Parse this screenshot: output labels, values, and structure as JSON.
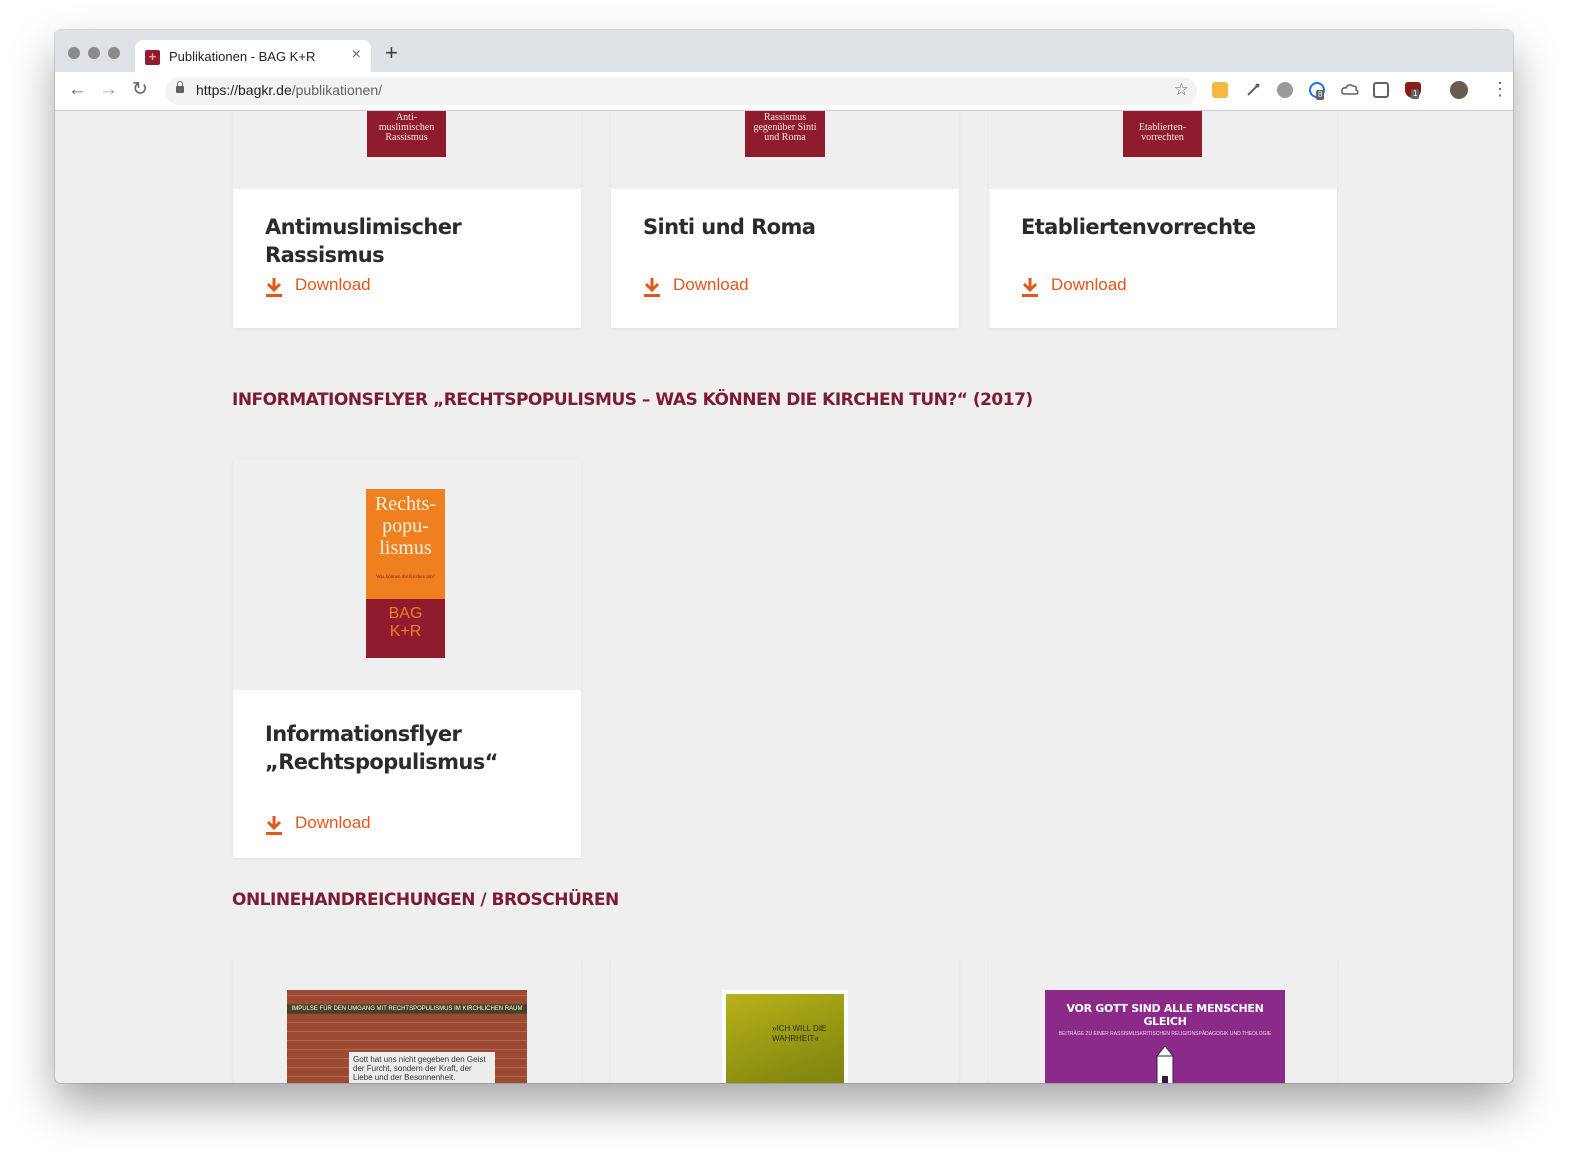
{
  "browser": {
    "tab_title": "Publikationen - BAG K+R",
    "tab_close": "×",
    "new_tab": "+",
    "url_host": "https://bagkr.de",
    "url_path": "/publikationen/",
    "back": "←",
    "forward": "→",
    "reload": "↻",
    "bookmark_star": "☆",
    "menu": "⋮",
    "extension_badges": {
      "ext4": "8",
      "ext8": "1"
    },
    "extensions": [
      "amazon-assistant-icon",
      "eyedropper-icon",
      "gear-extension-icon",
      "colorful-gear-extension-icon",
      "cloud-icon",
      "lightbulb-extension-icon",
      "ublock-extension-icon",
      "profile-avatar"
    ]
  },
  "colors": {
    "accent": "#e2571b",
    "heading": "#7d1b34",
    "cover_maroon": "#8e1c2e",
    "cover_orange": "#f07f20"
  },
  "covers": {
    "antimuslim": "Anti-\nmuslimischen\nRassismus",
    "sinti": "Rassismus\ngegenüber Sinti\nund Roma",
    "etabliert": "Etablierten-\nvorrechten",
    "flyer_title": "Rechts-\npopu-\nlismus",
    "flyer_sub": "Was können die Kirchen tun?",
    "flyer_logo_bag": "BAG",
    "flyer_logo_kr": "K+R",
    "brosch1_banner": "IMPULSE FÜR DEN UMGANG MIT RECHTSPOPULISMUS IM KIRCHLICHEN RAUM",
    "brosch1_quote": "Gott hat uns nicht gegeben den Geist der Furcht, sondern der Kraft, der Liebe und der Besonnenheit.",
    "brosch2_text": "»ICH WILL DIE WAHRHEIT«",
    "brosch3_title": "VOR GOTT SIND ALLE MENSCHEN GLEICH",
    "brosch3_sub": "BEITRÄGE ZU EINER RASSISMUSKRITISCHEN RELIGIONSPÄDAGOGIK UND THEOLOGIE"
  },
  "top_cards": [
    {
      "title": "Antimuslimischer Rassismus",
      "download": "Download"
    },
    {
      "title": "Sinti und Roma",
      "download": "Download"
    },
    {
      "title": "Etabliertenvorrechte",
      "download": "Download"
    }
  ],
  "flyer_section": {
    "heading": "INFORMATIONSFLYER „RECHTSPOPULISMUS – WAS KÖNNEN DIE KIRCHEN TUN?“ (2017)",
    "card": {
      "title_line1": "Informationsflyer",
      "title_line2": "„Rechtspopulismus“",
      "download": "Download"
    }
  },
  "online_section": {
    "heading": "ONLINEHANDREICHUNGEN / BROSCHÜREN"
  }
}
